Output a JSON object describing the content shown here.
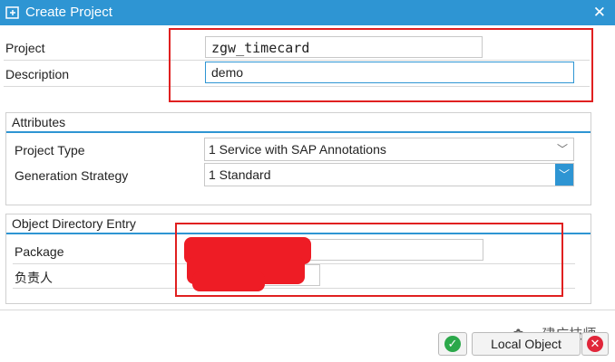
{
  "window": {
    "title": "Create Project",
    "close_icon": "close-icon"
  },
  "form": {
    "project_label": "Project",
    "project_value": "zgw_timecard",
    "description_label": "Description",
    "description_value": "demo"
  },
  "attributes": {
    "title": "Attributes",
    "project_type_label": "Project Type",
    "project_type_value": "1 Service with SAP Annotations",
    "generation_strategy_label": "Generation Strategy",
    "generation_strategy_value": "1 Standard"
  },
  "object_directory": {
    "title": "Object Directory Entry",
    "package_label": "Package",
    "package_value": "",
    "owner_label": "负责人",
    "owner_value": ""
  },
  "footer": {
    "ok_icon": "checkmark-icon",
    "local_object_label": "Local Object",
    "cancel_icon": "cancel-icon"
  },
  "colors": {
    "accent": "#2e95d3",
    "annotation_red": "#e02020",
    "ok_green": "#2ba84a",
    "cancel_red": "#e0263a"
  }
}
